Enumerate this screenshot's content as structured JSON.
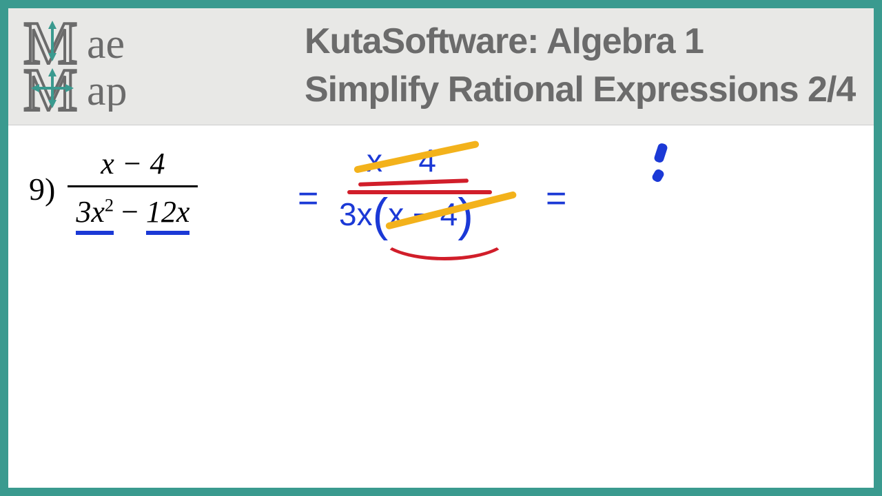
{
  "header": {
    "logo": {
      "top_text": "ae",
      "bottom_text": "ap",
      "brand": "MaeMap"
    },
    "title_line1": "KutaSoftware: Algebra 1",
    "title_line2": "Simplify Rational Expressions 2/4"
  },
  "problem": {
    "number": "9)",
    "numerator": "x − 4",
    "denominator_lhs": "3x",
    "denominator_exp": "2",
    "denominator_rhs": " − 12x"
  },
  "work": {
    "eq1": "=",
    "step1_num": "x − 4",
    "step1_den_factor": "3x",
    "step1_den_inner": "x − 4",
    "eq2": "=",
    "partial_answer": "1"
  },
  "colors": {
    "frame": "#3a9a8f",
    "header_bg": "#e8e8e6",
    "title_text": "#6b6b6b",
    "ink_blue": "#1b39d6",
    "ink_red": "#d11e2a",
    "ink_yellow": "#f3b21b"
  }
}
